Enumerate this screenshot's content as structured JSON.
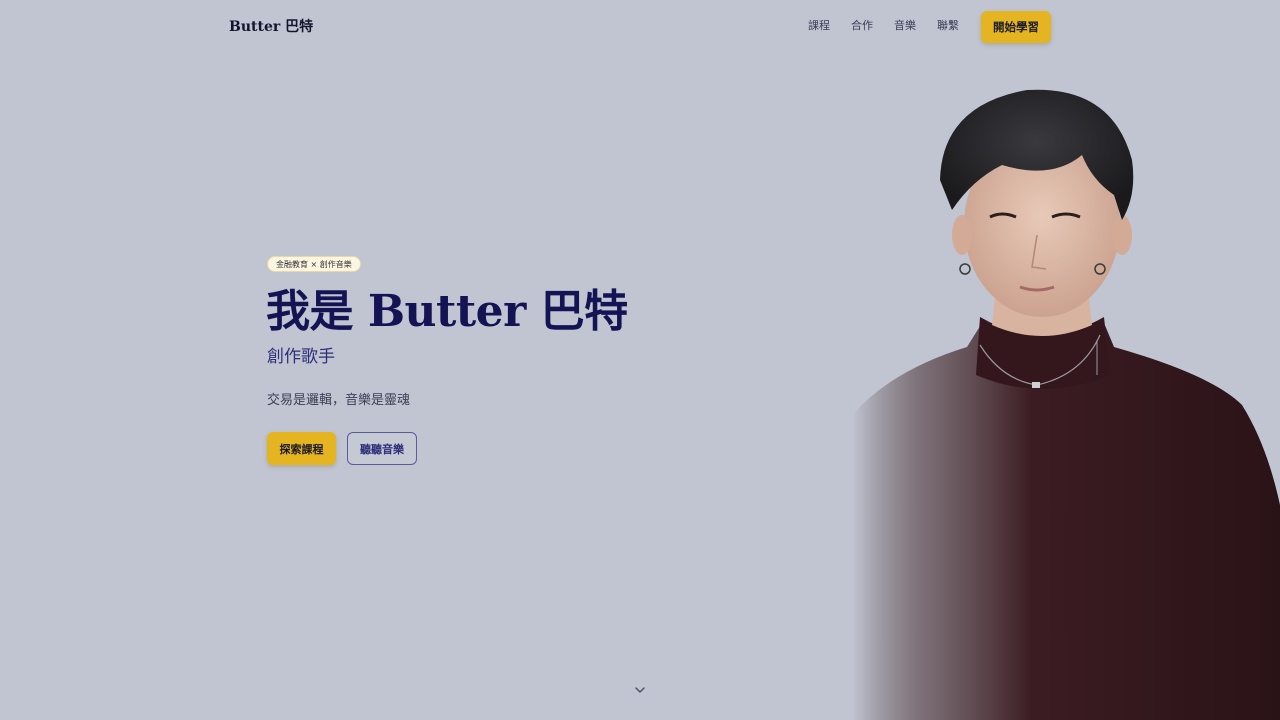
{
  "header": {
    "brand": "Butter 巴特",
    "nav": [
      "課程",
      "合作",
      "音樂",
      "聯繫"
    ],
    "cta_label": "開始學習"
  },
  "hero": {
    "badge": "金融教育 × 創作音樂",
    "title": "我是 Butter 巴特",
    "subtitle": "創作歌手",
    "tagline": "交易是邏輯，音樂是靈魂",
    "primary_button": "探索課程",
    "secondary_button": "聽聽音樂"
  },
  "icons": {
    "scroll": "chevron-down-icon"
  },
  "colors": {
    "background": "#c0c5d1",
    "accent": "#e5b421",
    "heading": "#141455",
    "subheading": "#2d2e79"
  }
}
